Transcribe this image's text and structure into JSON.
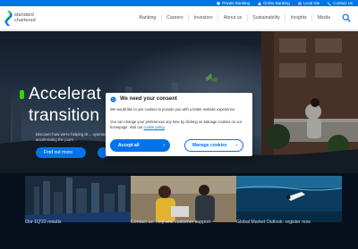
{
  "utility_bar": {
    "items": [
      {
        "label": "Private Banking",
        "icon": "gem-icon"
      },
      {
        "label": "Online Banking",
        "icon": "lock-icon"
      },
      {
        "label": "Local site",
        "icon": "globe-icon"
      },
      {
        "label": "Contact Us",
        "icon": "phone-icon"
      }
    ]
  },
  "header": {
    "logo_line1": "standard",
    "logo_line2": "chartered",
    "nav": [
      "Banking",
      "Careers",
      "Investors",
      "About us",
      "Sustainability",
      "Insights",
      "Media"
    ],
    "search_icon": "search-icon"
  },
  "hero": {
    "heading_line1": "Accelerat",
    "heading_line2": "transition",
    "sub": "Discover how we're helping th… operate, accelerating the journ…",
    "cta": "Find out more"
  },
  "tiles": [
    {
      "caption": "Our 1Q'22 results"
    },
    {
      "caption": "Contact us: help and customer support"
    },
    {
      "caption": "Global Market Outlook: register now"
    }
  ],
  "consent": {
    "title": "We need your consent",
    "p1": "We would like to use cookies to provide you with a better website experience.",
    "p2_prefix": "You can change your preferences any time by clicking on Manage cookies on our homepage. Visit our ",
    "p2_link": "cookie policy",
    "accept": "Accept all",
    "manage": "Manage cookies"
  },
  "colors": {
    "brand_blue": "#0473ea",
    "brand_green": "#38d200"
  }
}
